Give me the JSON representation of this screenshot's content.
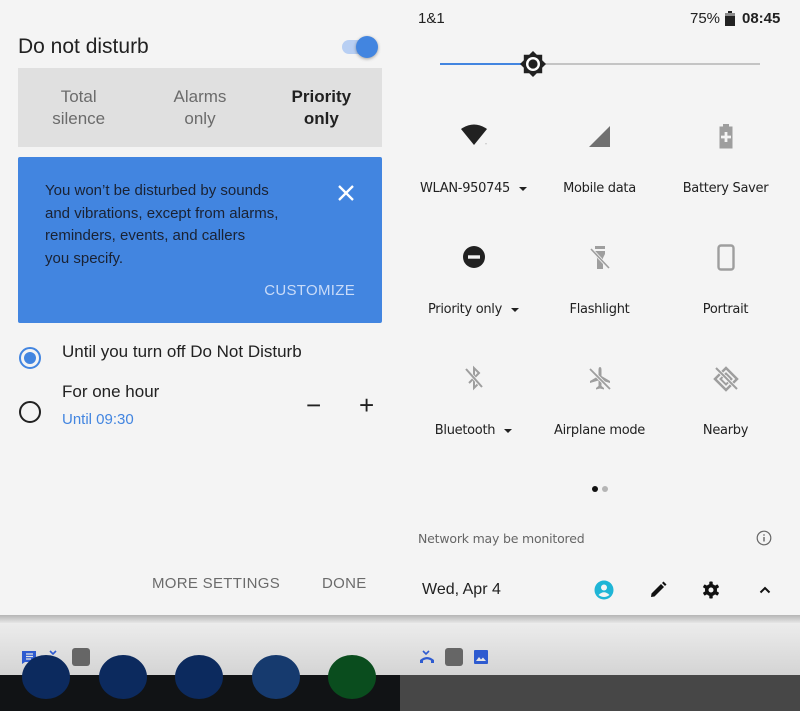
{
  "dnd_dialog": {
    "title": "Do not disturb",
    "toggle_on": true,
    "modes": [
      {
        "label_line1": "Total",
        "label_line2": "silence",
        "selected": false
      },
      {
        "label_line1": "Alarms",
        "label_line2": "only",
        "selected": false
      },
      {
        "label_line1": "Priority",
        "label_line2": "only",
        "selected": true
      }
    ],
    "info_card": {
      "line1": "You won’t be disturbed by sounds",
      "line2": "and vibrations, except from alarms,",
      "line3": "reminders, events, and callers",
      "line4": "you specify.",
      "close_icon": "close-icon",
      "action": "CUSTOMIZE"
    },
    "duration_options": [
      {
        "label": "Until you turn off Do Not Disturb",
        "selected": true
      },
      {
        "label": "For one hour",
        "sublabel": "Until 09:30",
        "selected": false,
        "minus": "−",
        "plus": "+"
      }
    ],
    "buttons": {
      "more_settings": "MORE SETTINGS",
      "done": "DONE"
    }
  },
  "quick_settings": {
    "status_bar": {
      "carrier": "1&1",
      "battery_percent": "75%",
      "time": "08:45"
    },
    "brightness_level": 0.29,
    "tiles": [
      {
        "label": "WLAN-950745",
        "icon": "wifi-icon",
        "has_dropdown": true,
        "active": true
      },
      {
        "label": "Mobile data",
        "icon": "signal-icon",
        "has_dropdown": false,
        "active": false
      },
      {
        "label": "Battery Saver",
        "icon": "battery-saver-icon",
        "has_dropdown": false,
        "active": false
      },
      {
        "label": "Priority only",
        "icon": "dnd-icon",
        "has_dropdown": true,
        "active": true
      },
      {
        "label": "Flashlight",
        "icon": "flashlight-off-icon",
        "has_dropdown": false,
        "active": false
      },
      {
        "label": "Portrait",
        "icon": "portrait-icon",
        "has_dropdown": false,
        "active": false
      },
      {
        "label": "Bluetooth",
        "icon": "bluetooth-off-icon",
        "has_dropdown": true,
        "active": false
      },
      {
        "label": "Airplane mode",
        "icon": "airplane-off-icon",
        "has_dropdown": false,
        "active": false
      },
      {
        "label": "Nearby",
        "icon": "nearby-off-icon",
        "has_dropdown": false,
        "active": false
      }
    ],
    "page_indicator": {
      "pages": 2,
      "current": 1
    },
    "network_message": "Network may be monitored",
    "footer": {
      "date": "Wed, Apr 4"
    }
  },
  "colors": {
    "accent": "#4285e0",
    "user_icon": "#1fb5d6",
    "inactive_icon": "#9e9e9e",
    "active_icon": "#212121"
  }
}
